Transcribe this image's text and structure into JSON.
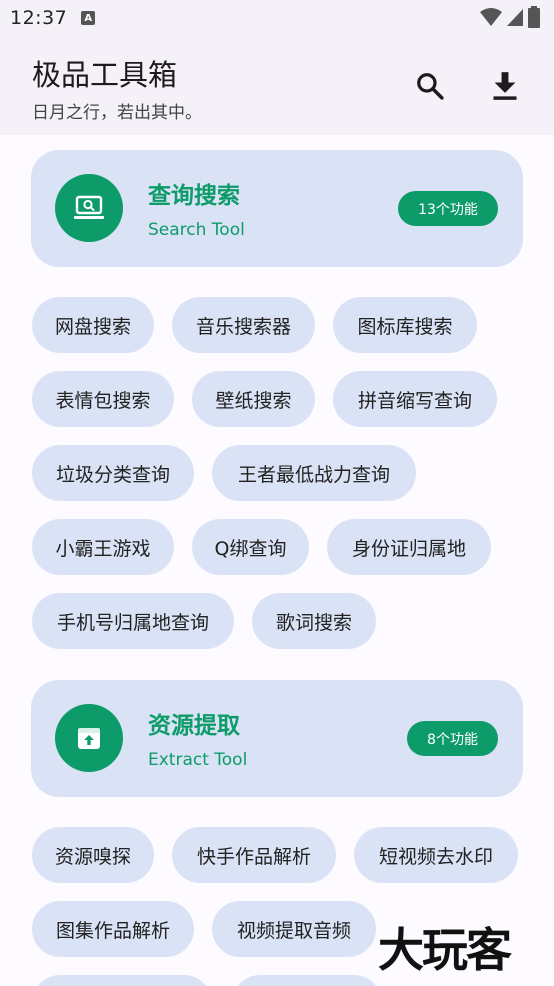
{
  "status_bar": {
    "time": "12:37"
  },
  "app_bar": {
    "title": "极品工具箱",
    "subtitle": "日月之行，若出其中。"
  },
  "sections": [
    {
      "title": "查询搜索",
      "subtitle": "Search Tool",
      "badge": "13个功能",
      "tools": [
        "网盘搜索",
        "音乐搜索器",
        "图标库搜索",
        "表情包搜索",
        "壁纸搜索",
        "拼音缩写查询",
        "垃圾分类查询",
        "王者最低战力查询",
        "小霸王游戏",
        "Q绑查询",
        "身份证归属地",
        "手机号归属地查询",
        "歌词搜索"
      ]
    },
    {
      "title": "资源提取",
      "subtitle": "Extract Tool",
      "badge": "8个功能",
      "tools": [
        "资源嗅探",
        "快手作品解析",
        "短视频去水印",
        "图集作品解析",
        "视频提取音频"
      ]
    }
  ],
  "watermark": "大玩客",
  "colors": {
    "accent": "#0d9b6a",
    "card": "#dae3f5"
  }
}
